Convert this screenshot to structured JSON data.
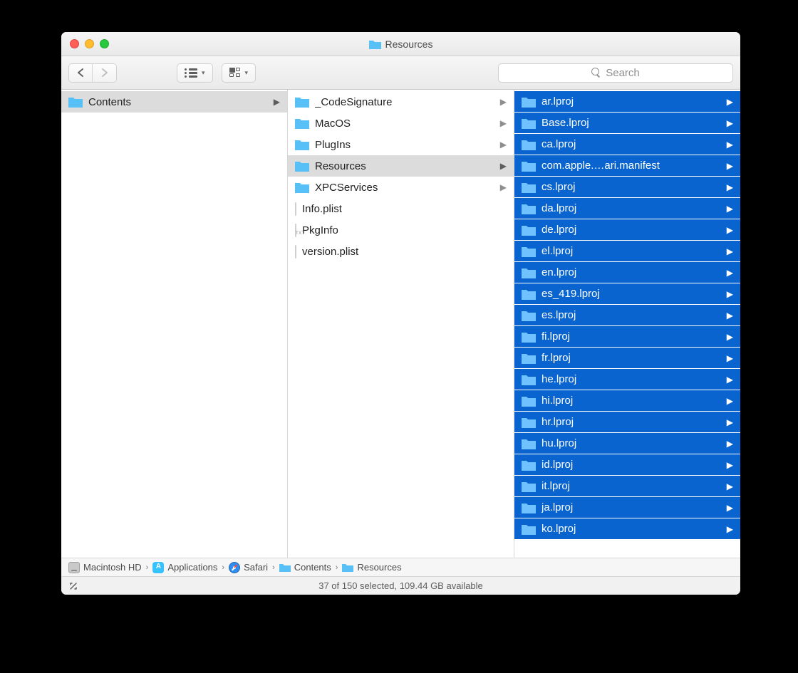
{
  "window": {
    "title": "Resources"
  },
  "toolbar": {
    "search_placeholder": "Search"
  },
  "columns": {
    "col0": {
      "items": [
        {
          "name": "Contents",
          "type": "folder",
          "chevron": true,
          "selected": true
        }
      ]
    },
    "col1": {
      "items": [
        {
          "name": "_CodeSignature",
          "type": "folder",
          "chevron": true
        },
        {
          "name": "MacOS",
          "type": "folder",
          "chevron": true
        },
        {
          "name": "PlugIns",
          "type": "folder",
          "chevron": true
        },
        {
          "name": "Resources",
          "type": "folder",
          "chevron": true,
          "selected": true
        },
        {
          "name": "XPCServices",
          "type": "folder",
          "chevron": true
        },
        {
          "name": "Info.plist",
          "type": "plist"
        },
        {
          "name": "PkgInfo",
          "type": "txt"
        },
        {
          "name": "version.plist",
          "type": "plist"
        }
      ]
    },
    "col2": {
      "items": [
        {
          "name": "ar.lproj",
          "type": "folder",
          "chevron": true,
          "selected": true
        },
        {
          "name": "Base.lproj",
          "type": "folder",
          "chevron": true,
          "selected": true
        },
        {
          "name": "ca.lproj",
          "type": "folder",
          "chevron": true,
          "selected": true
        },
        {
          "name": "com.apple.…ari.manifest",
          "type": "folder",
          "chevron": true,
          "selected": true
        },
        {
          "name": "cs.lproj",
          "type": "folder",
          "chevron": true,
          "selected": true
        },
        {
          "name": "da.lproj",
          "type": "folder",
          "chevron": true,
          "selected": true
        },
        {
          "name": "de.lproj",
          "type": "folder",
          "chevron": true,
          "selected": true
        },
        {
          "name": "el.lproj",
          "type": "folder",
          "chevron": true,
          "selected": true
        },
        {
          "name": "en.lproj",
          "type": "folder",
          "chevron": true,
          "selected": true
        },
        {
          "name": "es_419.lproj",
          "type": "folder",
          "chevron": true,
          "selected": true
        },
        {
          "name": "es.lproj",
          "type": "folder",
          "chevron": true,
          "selected": true
        },
        {
          "name": "fi.lproj",
          "type": "folder",
          "chevron": true,
          "selected": true
        },
        {
          "name": "fr.lproj",
          "type": "folder",
          "chevron": true,
          "selected": true
        },
        {
          "name": "he.lproj",
          "type": "folder",
          "chevron": true,
          "selected": true
        },
        {
          "name": "hi.lproj",
          "type": "folder",
          "chevron": true,
          "selected": true
        },
        {
          "name": "hr.lproj",
          "type": "folder",
          "chevron": true,
          "selected": true
        },
        {
          "name": "hu.lproj",
          "type": "folder",
          "chevron": true,
          "selected": true
        },
        {
          "name": "id.lproj",
          "type": "folder",
          "chevron": true,
          "selected": true
        },
        {
          "name": "it.lproj",
          "type": "folder",
          "chevron": true,
          "selected": true
        },
        {
          "name": "ja.lproj",
          "type": "folder",
          "chevron": true,
          "selected": true
        },
        {
          "name": "ko.lproj",
          "type": "folder",
          "chevron": true,
          "selected": true
        }
      ]
    }
  },
  "pathbar": {
    "items": [
      {
        "name": "Macintosh HD",
        "icon": "disk"
      },
      {
        "name": "Applications",
        "icon": "app"
      },
      {
        "name": "Safari",
        "icon": "safari"
      },
      {
        "name": "Contents",
        "icon": "folder"
      },
      {
        "name": "Resources",
        "icon": "folder"
      }
    ]
  },
  "status": {
    "text": "37 of 150 selected, 109.44 GB available"
  }
}
